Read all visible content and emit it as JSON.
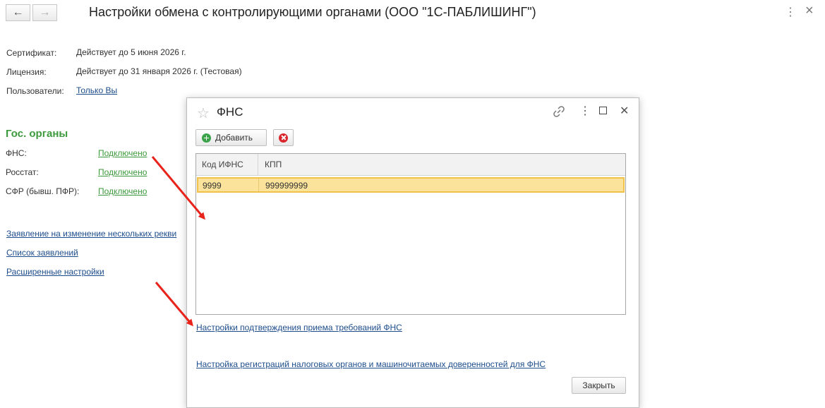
{
  "window": {
    "title": "Настройки обмена с контролирующими органами (ООО \"1С-ПАБЛИШИНГ\")",
    "back_icon": "←",
    "forward_icon": "→",
    "more_icon": "⋮",
    "close_icon": "×"
  },
  "info": {
    "certificate_label": "Сертификат:",
    "certificate_value": "Действует до 5 июня 2026 г.",
    "license_label": "Лицензия:",
    "license_value": "Действует до 31 января 2026 г. (Тестовая)",
    "users_label": "Пользователи:",
    "users_value": "Только Вы"
  },
  "gov": {
    "heading": "Гос. органы",
    "items": [
      {
        "label": "ФНС:",
        "status": "Подключено"
      },
      {
        "label": "Росстат:",
        "status": "Подключено"
      },
      {
        "label": "СФР (бывш. ПФР):",
        "status": "Подключено"
      }
    ]
  },
  "links": {
    "change_statement": "Заявление на изменение нескольких рекви",
    "statements_list": "Список заявлений",
    "advanced_settings": "Расширенные настройки"
  },
  "dialog": {
    "title": "ФНС",
    "star_icon": "☆",
    "link_icon": "🔗",
    "more_icon": "⋮",
    "maximize_icon": "□",
    "close_icon": "✕",
    "add_label": "Добавить",
    "columns": [
      "Код ИФНС",
      "КПП"
    ],
    "rows": [
      {
        "code": "9999",
        "kpp": "999999999"
      }
    ],
    "link_confirm": "Настройки подтверждения приема требований ФНС",
    "link_registration": "Настройка регистраций налоговых органов и машиночитаемых доверенностей для ФНС",
    "close_label": "Закрыть"
  },
  "colors": {
    "link_blue": "#1d4d8c",
    "status_green": "#3c9a3c",
    "selection": "#fbe39b",
    "annotation_arrow": "#e8231b"
  }
}
